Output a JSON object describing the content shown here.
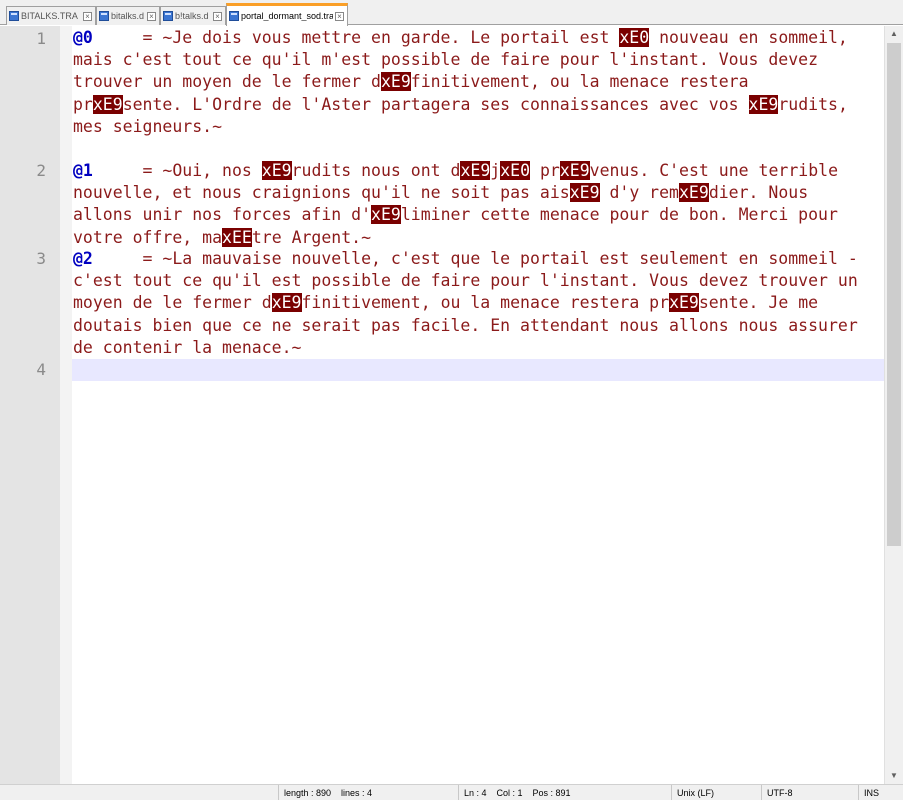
{
  "tabs": [
    {
      "label": "BITALKS.TRA",
      "close": "×",
      "active": false
    },
    {
      "label": "bitalks.d",
      "close": "×",
      "active": false
    },
    {
      "label": "b!talks.d",
      "close": "×",
      "active": false
    },
    {
      "label": "portal_dormant_sod.tra",
      "close": "×",
      "active": true
    }
  ],
  "editor": {
    "line_numbers": [
      "1",
      "2",
      "3",
      "4"
    ],
    "lines": [
      [
        {
          "t": "@0",
          "c": "key"
        },
        {
          "t": "     = ~Je dois vous mettre en garde. Le portail est "
        },
        {
          "t": "xE0",
          "c": "esc"
        },
        {
          "t": " nouveau en sommeil, mais c'est tout ce qu'il m'est possible de faire pour l'instant. Vous devez trouver un moyen de le fermer d"
        },
        {
          "t": "xE9",
          "c": "esc"
        },
        {
          "t": "finitivement, ou la menace restera pr"
        },
        {
          "t": "xE9",
          "c": "esc"
        },
        {
          "t": "sente. L'Ordre de l'Aster partagera ses connaissances avec vos "
        },
        {
          "t": "xE9",
          "c": "esc"
        },
        {
          "t": "rudits, mes seigneurs.~"
        }
      ],
      [
        {
          "t": "@1",
          "c": "key"
        },
        {
          "t": "     = ~Oui, nos "
        },
        {
          "t": "xE9",
          "c": "esc"
        },
        {
          "t": "rudits nous ont d"
        },
        {
          "t": "xE9",
          "c": "esc"
        },
        {
          "t": "j"
        },
        {
          "t": "xE0",
          "c": "esc"
        },
        {
          "t": " pr"
        },
        {
          "t": "xE9",
          "c": "esc"
        },
        {
          "t": "venus. C'est une terrible nouvelle, et nous craignions qu'il ne soit pas ais"
        },
        {
          "t": "xE9",
          "c": "esc"
        },
        {
          "t": " d'y rem"
        },
        {
          "t": "xE9",
          "c": "esc"
        },
        {
          "t": "dier. Nous allons unir nos forces afin d'"
        },
        {
          "t": "xE9",
          "c": "esc"
        },
        {
          "t": "liminer cette menace pour de bon. Merci pour votre offre, ma"
        },
        {
          "t": "xEE",
          "c": "esc"
        },
        {
          "t": "tre Argent.~"
        }
      ],
      [
        {
          "t": "@2",
          "c": "key"
        },
        {
          "t": "     = ~La mauvaise nouvelle, c'est que le portail est seulement en sommeil - c'est tout ce qu'il est possible de faire pour l'instant. Vous devez trouver un moyen de le fermer d"
        },
        {
          "t": "xE9",
          "c": "esc"
        },
        {
          "t": "finitivement, ou la menace restera pr"
        },
        {
          "t": "xE9",
          "c": "esc"
        },
        {
          "t": "sente. Je me doutais bien que ce ne serait pas facile. En attendant nous allons nous assurer de contenir la menace.~"
        }
      ],
      []
    ]
  },
  "scrollbar": {
    "up": "▲",
    "down": "▼"
  },
  "status": {
    "length_lines": "length : 890    lines : 4",
    "position": "Ln : 4    Col : 1    Pos : 891",
    "eol": "Unix (LF)",
    "encoding": "UTF-8",
    "mode": "INS"
  }
}
